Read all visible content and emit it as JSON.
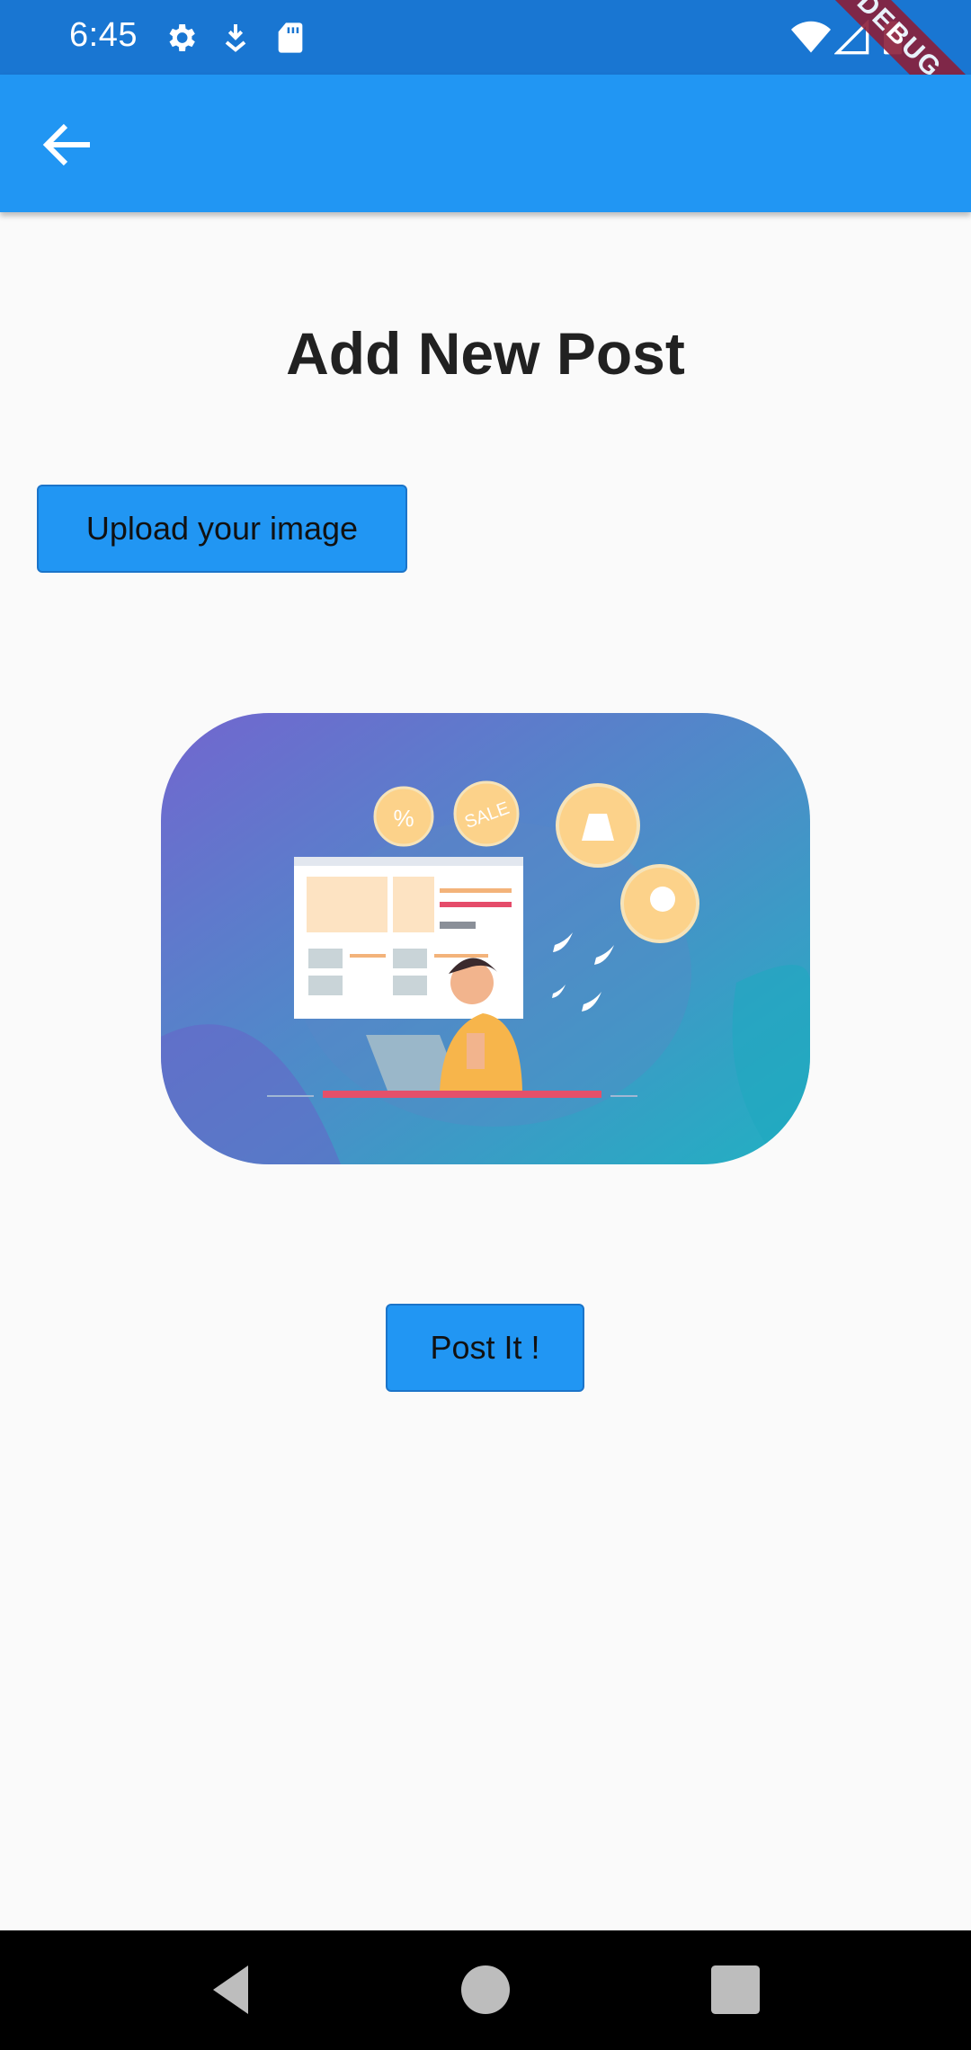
{
  "status_bar": {
    "time": "6:45",
    "icons": [
      "settings-icon",
      "download-icon",
      "sd-card-icon",
      "wifi-icon",
      "signal-icon",
      "battery-icon"
    ]
  },
  "debug_banner": "DEBUG",
  "app_bar": {
    "back_icon": "arrow-back-icon",
    "color": "#2196f3"
  },
  "page": {
    "title": "Add New Post",
    "upload_button_label": "Upload your image",
    "post_button_label": "Post It !"
  },
  "illustration": {
    "badges": [
      "%",
      "SALE"
    ]
  },
  "nav_bar": {
    "icons": [
      "back-triangle-icon",
      "home-circle-icon",
      "recents-square-icon"
    ]
  }
}
